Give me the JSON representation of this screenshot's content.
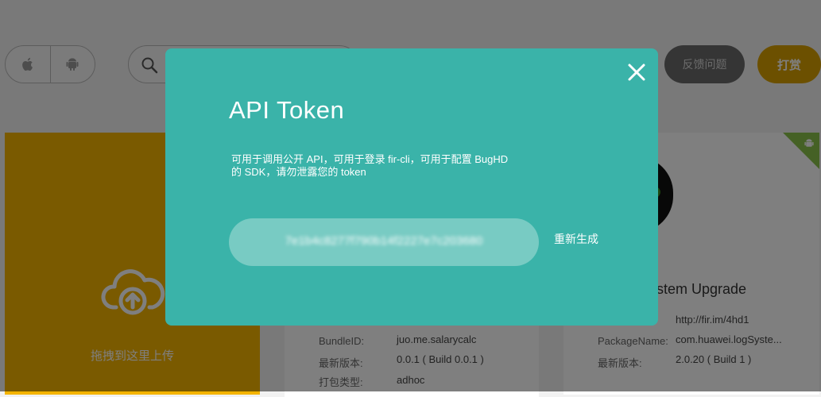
{
  "header": {
    "platform_ios_icon": "apple-icon",
    "platform_android_icon": "android-icon",
    "search_icon": "search-icon",
    "feedback_label": "反馈问题",
    "tip_label": "打赏"
  },
  "upload": {
    "label": "拖拽到这里上传",
    "icon": "cloud-upload-icon"
  },
  "card_mid": {
    "rows": [
      {
        "key": "BundleID:",
        "value": "juo.me.salarycalc"
      },
      {
        "key": "最新版本:",
        "value": "0.0.1 ( Build 0.0.1 )"
      },
      {
        "key": "打包类型:",
        "value": "adhoc"
      }
    ]
  },
  "card_right": {
    "name_visible": "stem Upgrade",
    "short_url": "http://fir.im/4hd1",
    "rows": [
      {
        "key": "PackageName:",
        "value": "com.huawei.logSyste..."
      },
      {
        "key": "最新版本:",
        "value": "2.0.20 ( Build 1 )"
      }
    ],
    "platform_badge_icon": "android-icon"
  },
  "modal": {
    "title": "API  Token",
    "desc_line1": "可用于调用公开 API，可用于登录 fir-cli，可用于配置 BugHD",
    "desc_line2": "的 SDK，请勿泄露您的 token",
    "token_value": "7e1b4c8277f790b14f2227e7c203680",
    "regenerate_label": "重新生成",
    "close_icon": "close-icon"
  },
  "colors": {
    "modal_bg": "#3ab3a9",
    "upload_bg": "#f4b400",
    "tip_bg": "#d9a100",
    "feedback_bg": "#6a6a6a",
    "badge": "#8bc34a"
  }
}
